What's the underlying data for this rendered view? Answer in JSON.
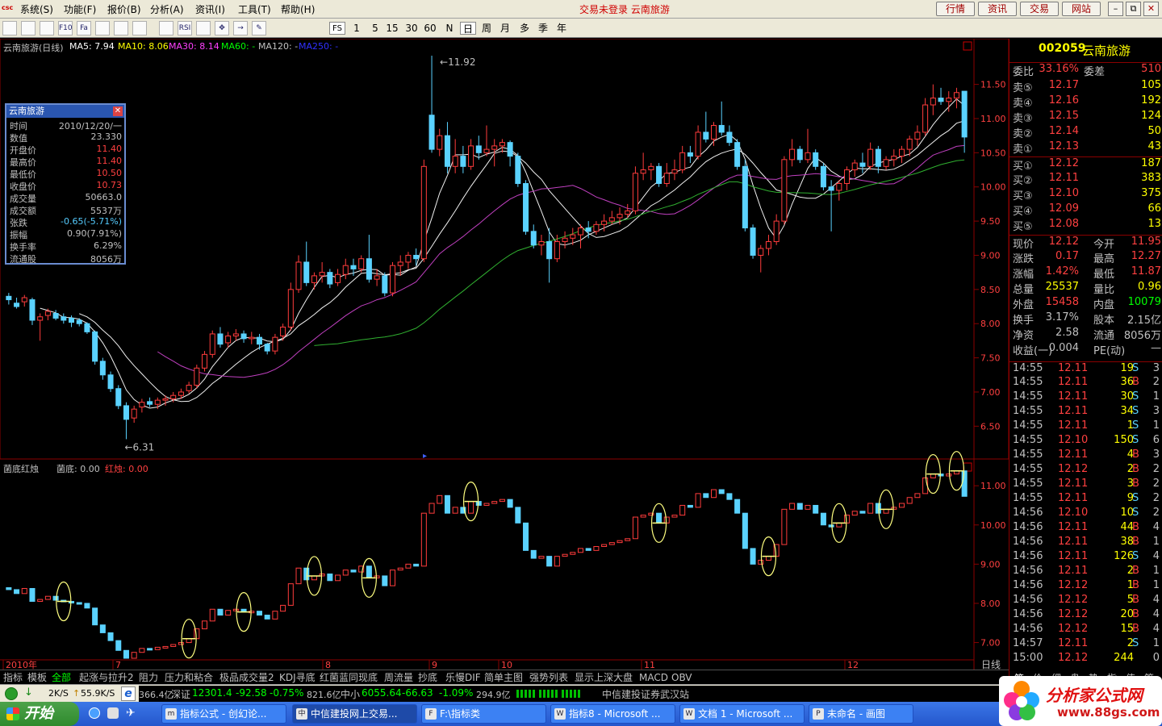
{
  "menubar": {
    "logo": "csc",
    "items": [
      "系统(S)",
      "功能(F)",
      "报价(B)",
      "分析(A)",
      "资讯(I)",
      "工具(T)",
      "帮助(H)"
    ],
    "notice": "交易未登录 云南旅游",
    "buttons": [
      "行情",
      "资讯",
      "交易",
      "网站"
    ],
    "win_min": "–",
    "win_restore": "⧉",
    "win_close": "✕"
  },
  "toolbar": {
    "icons": [
      "list-icon",
      "grid-icon",
      "line-chart-icon",
      "f10-icon",
      "fa-icon",
      "candlestick-icon",
      "bar-icon",
      "compare-icon",
      "multi-icon",
      "rsi-icon",
      "pattern-icon",
      "move-icon",
      "arrow-icon",
      "pencil-icon"
    ],
    "icon_text": [
      "",
      "",
      "",
      "F10",
      "Fa",
      "",
      "",
      "",
      "",
      "RSI",
      "",
      "✥",
      "→",
      "✎"
    ],
    "fs": "FS",
    "periods": [
      "1",
      "5",
      "15",
      "30",
      "60",
      "N",
      "日",
      "周",
      "月",
      "多",
      "季",
      "年"
    ],
    "selected_period": "日"
  },
  "chart_header": {
    "name": "云南旅游(日线)",
    "ma5": "MA5: 7.94",
    "ma10": "MA10: 8.06",
    "ma30": "MA30: 8.14",
    "ma60": "MA60: -",
    "ma120": "MA120: -",
    "ma250": "MA250: -"
  },
  "infobox": {
    "title": "云南旅游",
    "close": "✕",
    "rows": [
      {
        "k": "时间",
        "v": "2010/12/20/一",
        "c": "#c0c0c0"
      },
      {
        "k": "数值",
        "v": "23.330",
        "c": "#c0c0c0"
      },
      {
        "k": "开盘价",
        "v": "11.40",
        "c": "#ff4040"
      },
      {
        "k": "最高价",
        "v": "11.40",
        "c": "#ff4040"
      },
      {
        "k": "最低价",
        "v": "10.50",
        "c": "#ff4040"
      },
      {
        "k": "收盘价",
        "v": "10.73",
        "c": "#ff4040"
      },
      {
        "k": "成交量",
        "v": "50663.0",
        "c": "#c0c0c0"
      },
      {
        "k": "成交额",
        "v": "5537万",
        "c": "#c0c0c0"
      },
      {
        "k": "张跌",
        "v": "-0.65(-5.71%)",
        "c": "#5cf"
      },
      {
        "k": "振幅",
        "v": "0.90(7.91%)",
        "c": "#c0c0c0"
      },
      {
        "k": "换手率",
        "v": "6.29%",
        "c": "#c0c0c0"
      },
      {
        "k": "流通股",
        "v": "8056万",
        "c": "#c0c0c0"
      }
    ]
  },
  "price_axis": [
    "11.50",
    "11.00",
    "10.50",
    "10.00",
    "9.50",
    "9.00",
    "8.50",
    "8.00",
    "7.50",
    "7.00",
    "6.50"
  ],
  "annotations": {
    "high": "11.92",
    "low": "6.31"
  },
  "indicator_header": {
    "name": "菌底红烛",
    "v1": "菌底: 0.00",
    "v2": "红烛: 0.00"
  },
  "indicator_axis": [
    "11.00",
    "10.00",
    "9.00",
    "8.00",
    "7.00"
  ],
  "date_axis": [
    "2010年",
    "7",
    "8",
    "9",
    "10",
    "11",
    "12"
  ],
  "period_label": "日线",
  "tabs": [
    "指标",
    "模板",
    "全部",
    "起涨与拉升2",
    "阻力",
    "压力和粘合",
    "极品成交量2",
    "KDJ寻底",
    "红菌蓝同现底",
    "周流量",
    "抄底",
    "乐慢DIF",
    "简单主图",
    "强势列表",
    "显示上深大盘",
    "MACD",
    "OBV"
  ],
  "quote": {
    "code": "002059",
    "name": "云南旅游",
    "webi_label": "委比",
    "webi": "33.16%",
    "wecha_label": "委差",
    "wecha": "510",
    "asks": [
      {
        "l": "卖⑤",
        "p": "12.17",
        "v": "105"
      },
      {
        "l": "卖④",
        "p": "12.16",
        "v": "192"
      },
      {
        "l": "卖③",
        "p": "12.15",
        "v": "124"
      },
      {
        "l": "卖②",
        "p": "12.14",
        "v": "50"
      },
      {
        "l": "卖①",
        "p": "12.13",
        "v": "43"
      }
    ],
    "bids": [
      {
        "l": "买①",
        "p": "12.12",
        "v": "187"
      },
      {
        "l": "买②",
        "p": "12.11",
        "v": "383"
      },
      {
        "l": "买③",
        "p": "12.10",
        "v": "375"
      },
      {
        "l": "买④",
        "p": "12.09",
        "v": "66"
      },
      {
        "l": "买⑤",
        "p": "12.08",
        "v": "13"
      }
    ],
    "stats": [
      {
        "l1": "现价",
        "v1": "12.12",
        "c1": "#ff4040",
        "l2": "今开",
        "v2": "11.95",
        "c2": "#ff4040"
      },
      {
        "l1": "涨跌",
        "v1": "0.17",
        "c1": "#ff4040",
        "l2": "最高",
        "v2": "12.27",
        "c2": "#ff4040"
      },
      {
        "l1": "涨幅",
        "v1": "1.42%",
        "c1": "#ff4040",
        "l2": "最低",
        "v2": "11.87",
        "c2": "#ff4040"
      },
      {
        "l1": "总量",
        "v1": "25537",
        "c1": "#ffff00",
        "l2": "量比",
        "v2": "0.96",
        "c2": "#ffff00"
      },
      {
        "l1": "外盘",
        "v1": "15458",
        "c1": "#ff4040",
        "l2": "内盘",
        "v2": "10079",
        "c2": "#00ff00"
      },
      {
        "l1": "换手",
        "v1": "3.17%",
        "c1": "#c0c0c0",
        "l2": "股本",
        "v2": "2.15亿",
        "c2": "#c0c0c0"
      },
      {
        "l1": "净资",
        "v1": "2.58",
        "c1": "#c0c0c0",
        "l2": "流通",
        "v2": "8056万",
        "c2": "#c0c0c0"
      },
      {
        "l1": "收益(一)",
        "v1": "0.004",
        "c1": "#c0c0c0",
        "l2": "PE(动)",
        "v2": "—",
        "c2": "#c0c0c0"
      }
    ],
    "ticks": [
      {
        "t": "14:55",
        "p": "12.11",
        "v": "19",
        "s": "S",
        "n": "3"
      },
      {
        "t": "14:55",
        "p": "12.11",
        "v": "36",
        "s": "B",
        "n": "2"
      },
      {
        "t": "14:55",
        "p": "12.11",
        "v": "30",
        "s": "S",
        "n": "1"
      },
      {
        "t": "14:55",
        "p": "12.11",
        "v": "34",
        "s": "S",
        "n": "3"
      },
      {
        "t": "14:55",
        "p": "12.11",
        "v": "1",
        "s": "S",
        "n": "1"
      },
      {
        "t": "14:55",
        "p": "12.10",
        "v": "150",
        "s": "S",
        "n": "6"
      },
      {
        "t": "14:55",
        "p": "12.11",
        "v": "4",
        "s": "B",
        "n": "3"
      },
      {
        "t": "14:55",
        "p": "12.12",
        "v": "2",
        "s": "B",
        "n": "2"
      },
      {
        "t": "14:55",
        "p": "12.11",
        "v": "3",
        "s": "B",
        "n": "2"
      },
      {
        "t": "14:55",
        "p": "12.11",
        "v": "9",
        "s": "S",
        "n": "2"
      },
      {
        "t": "14:56",
        "p": "12.10",
        "v": "10",
        "s": "S",
        "n": "2"
      },
      {
        "t": "14:56",
        "p": "12.11",
        "v": "44",
        "s": "B",
        "n": "4"
      },
      {
        "t": "14:56",
        "p": "12.11",
        "v": "38",
        "s": "B",
        "n": "1"
      },
      {
        "t": "14:56",
        "p": "12.11",
        "v": "126",
        "s": "S",
        "n": "4"
      },
      {
        "t": "14:56",
        "p": "12.11",
        "v": "2",
        "s": "B",
        "n": "1"
      },
      {
        "t": "14:56",
        "p": "12.12",
        "v": "1",
        "s": "B",
        "n": "1"
      },
      {
        "t": "14:56",
        "p": "12.12",
        "v": "5",
        "s": "B",
        "n": "4"
      },
      {
        "t": "14:56",
        "p": "12.12",
        "v": "20",
        "s": "B",
        "n": "4"
      },
      {
        "t": "14:56",
        "p": "12.12",
        "v": "15",
        "s": "B",
        "n": "4"
      },
      {
        "t": "14:57",
        "p": "12.11",
        "v": "2",
        "s": "S",
        "n": "1"
      },
      {
        "t": "15:00",
        "p": "12.12",
        "v": "244",
        "s": "",
        "n": "0"
      }
    ],
    "bottom_tabs": [
      "笔",
      "价",
      "细",
      "盘",
      "势",
      "指",
      "值",
      "筹"
    ]
  },
  "statusbar": {
    "icons": [
      "network-icon",
      "download-arrow-icon"
    ],
    "down": "2K/S",
    "up": "55.9K/S",
    "ie": "e",
    "market": "366.4亿",
    "sz_label": "深证",
    "sz": "12301.4",
    "sz_chg": "-92.58",
    "sz_pct": "-0.75%",
    "sz_amt": "821.6亿",
    "zx_label": "中小",
    "zx": "6055.64",
    "zx_chg": "-66.63",
    "zx_pct": "-1.09%",
    "zx_amt": "294.9亿",
    "broker": "中信建投证券武汉站"
  },
  "taskbar": {
    "start": "开始",
    "tasks": [
      {
        "icon": "m",
        "label": "指标公式 - 创幻论..."
      },
      {
        "icon": "中",
        "label": "中信建投网上交易..."
      },
      {
        "icon": "F",
        "label": "F:\\指标类"
      },
      {
        "icon": "W",
        "label": "指标8 - Microsoft ..."
      },
      {
        "icon": "W",
        "label": "文档 1 - Microsoft ..."
      },
      {
        "icon": "P",
        "label": "未命名 - 画图"
      }
    ]
  },
  "watermark": {
    "title": "分析家公式网",
    "url": "www.88gs.com"
  },
  "colors": {
    "up": "#ff3c3c",
    "down": "#5ad2ff",
    "ma5": "#ffffff",
    "ma10": "#ffff00",
    "ma30": "#ff40ff",
    "ma60": "#00ff00",
    "ma120": "#c0c0c0",
    "ma250": "#0000ff",
    "ma_drawn_white": "#f0f0f0",
    "ma_drawn_magenta": "#c040c0",
    "ma_drawn_green": "#30b030",
    "accent_red": "#8b0000"
  },
  "chart_data": {
    "type": "candlestick",
    "y_range": [
      6.15,
      12.05
    ],
    "candles": [
      [
        8.4,
        8.45,
        8.28,
        8.35
      ],
      [
        8.3,
        8.38,
        8.22,
        8.25
      ],
      [
        8.32,
        8.42,
        8.25,
        8.38
      ],
      [
        8.35,
        8.38,
        7.98,
        8.05
      ],
      [
        8.05,
        8.15,
        7.75,
        8.1
      ],
      [
        8.12,
        8.22,
        8.05,
        8.18
      ],
      [
        8.15,
        8.2,
        8.05,
        8.08
      ],
      [
        8.1,
        8.15,
        8.0,
        8.05
      ],
      [
        8.08,
        8.12,
        7.95,
        8.02
      ],
      [
        8.05,
        8.08,
        7.96,
        8.0
      ],
      [
        8.0,
        8.02,
        7.85,
        7.88
      ],
      [
        7.88,
        7.9,
        7.4,
        7.45
      ],
      [
        7.45,
        7.5,
        7.18,
        7.25
      ],
      [
        7.25,
        7.3,
        7.0,
        7.05
      ],
      [
        7.05,
        7.1,
        6.75,
        6.8
      ],
      [
        6.8,
        6.85,
        6.31,
        6.6
      ],
      [
        6.62,
        6.8,
        6.55,
        6.75
      ],
      [
        6.78,
        6.9,
        6.7,
        6.85
      ],
      [
        6.86,
        6.92,
        6.78,
        6.82
      ],
      [
        6.82,
        6.92,
        6.75,
        6.88
      ],
      [
        6.88,
        6.95,
        6.8,
        6.9
      ],
      [
        6.9,
        7.0,
        6.85,
        6.95
      ],
      [
        6.95,
        7.05,
        6.9,
        7.0
      ],
      [
        7.02,
        7.15,
        6.98,
        7.1
      ],
      [
        7.1,
        7.4,
        7.05,
        7.35
      ],
      [
        7.35,
        7.6,
        7.3,
        7.55
      ],
      [
        7.55,
        7.9,
        7.5,
        7.85
      ],
      [
        7.85,
        7.95,
        7.65,
        7.7
      ],
      [
        7.72,
        7.88,
        7.65,
        7.82
      ],
      [
        7.82,
        7.92,
        7.75,
        7.85
      ],
      [
        7.85,
        7.9,
        7.72,
        7.78
      ],
      [
        7.78,
        7.88,
        7.7,
        7.8
      ],
      [
        7.8,
        7.85,
        7.62,
        7.7
      ],
      [
        7.7,
        7.72,
        7.55,
        7.6
      ],
      [
        7.6,
        7.85,
        7.55,
        7.8
      ],
      [
        7.82,
        8.0,
        7.75,
        7.95
      ],
      [
        7.95,
        8.6,
        7.9,
        8.5
      ],
      [
        8.5,
        9.0,
        8.45,
        8.9
      ],
      [
        8.9,
        9.2,
        8.55,
        8.6
      ],
      [
        8.6,
        8.75,
        8.5,
        8.7
      ],
      [
        8.7,
        8.9,
        8.6,
        8.75
      ],
      [
        8.75,
        8.8,
        8.52,
        8.58
      ],
      [
        8.6,
        8.8,
        8.55,
        8.72
      ],
      [
        8.72,
        8.95,
        8.65,
        8.85
      ],
      [
        8.85,
        8.95,
        8.7,
        8.8
      ],
      [
        8.8,
        9.0,
        8.75,
        8.95
      ],
      [
        8.95,
        9.3,
        8.6,
        8.65
      ],
      [
        8.65,
        8.8,
        8.55,
        8.7
      ],
      [
        8.7,
        8.75,
        8.4,
        8.45
      ],
      [
        8.45,
        8.9,
        8.4,
        8.85
      ],
      [
        8.85,
        9.0,
        8.7,
        8.9
      ],
      [
        8.9,
        9.05,
        8.8,
        9.0
      ],
      [
        9.0,
        9.1,
        8.85,
        8.95
      ],
      [
        8.95,
        10.4,
        8.9,
        10.3
      ],
      [
        11.05,
        11.92,
        10.5,
        10.55
      ],
      [
        10.55,
        10.85,
        10.45,
        10.75
      ],
      [
        10.75,
        10.95,
        10.2,
        10.3
      ],
      [
        10.3,
        10.7,
        10.2,
        10.45
      ],
      [
        10.45,
        10.6,
        10.2,
        10.3
      ],
      [
        10.3,
        10.7,
        10.25,
        10.6
      ],
      [
        10.6,
        10.75,
        10.4,
        10.5
      ],
      [
        10.5,
        10.9,
        10.45,
        10.55
      ],
      [
        10.55,
        10.7,
        10.3,
        10.6
      ],
      [
        10.6,
        10.7,
        10.5,
        10.65
      ],
      [
        10.65,
        10.68,
        10.3,
        10.45
      ],
      [
        10.45,
        10.5,
        10.0,
        10.05
      ],
      [
        10.05,
        10.1,
        9.3,
        9.35
      ],
      [
        9.35,
        9.45,
        9.1,
        9.15
      ],
      [
        9.15,
        9.3,
        9.0,
        9.2
      ],
      [
        9.2,
        9.4,
        8.6,
        8.95
      ],
      [
        8.95,
        9.3,
        8.9,
        9.2
      ],
      [
        9.2,
        9.35,
        9.1,
        9.25
      ],
      [
        9.25,
        9.4,
        9.15,
        9.3
      ],
      [
        9.3,
        9.45,
        9.1,
        9.4
      ],
      [
        9.4,
        9.5,
        9.25,
        9.35
      ],
      [
        9.35,
        9.5,
        9.3,
        9.45
      ],
      [
        9.45,
        9.6,
        9.35,
        9.5
      ],
      [
        9.5,
        9.65,
        9.45,
        9.55
      ],
      [
        9.55,
        9.7,
        9.45,
        9.6
      ],
      [
        9.6,
        9.75,
        9.55,
        9.65
      ],
      [
        9.65,
        10.3,
        9.6,
        10.2
      ],
      [
        10.2,
        10.5,
        10.1,
        10.25
      ],
      [
        10.25,
        10.35,
        10.1,
        10.3
      ],
      [
        10.3,
        10.35,
        10.0,
        10.05
      ],
      [
        10.05,
        10.35,
        10.0,
        10.2
      ],
      [
        10.2,
        10.4,
        10.1,
        10.25
      ],
      [
        10.25,
        10.6,
        10.2,
        10.5
      ],
      [
        10.5,
        10.6,
        10.35,
        10.45
      ],
      [
        10.45,
        10.9,
        10.4,
        10.8
      ],
      [
        10.8,
        11.1,
        10.65,
        10.7
      ],
      [
        10.7,
        10.95,
        10.6,
        10.9
      ],
      [
        10.9,
        11.25,
        10.75,
        10.8
      ],
      [
        10.8,
        10.9,
        10.6,
        10.65
      ],
      [
        10.65,
        10.7,
        10.25,
        10.3
      ],
      [
        10.3,
        10.4,
        9.35,
        9.4
      ],
      [
        9.4,
        9.45,
        8.95,
        9.0
      ],
      [
        9.0,
        9.15,
        8.75,
        9.1
      ],
      [
        9.1,
        9.3,
        9.0,
        9.2
      ],
      [
        9.2,
        9.6,
        9.15,
        9.5
      ],
      [
        9.5,
        10.45,
        9.45,
        10.4
      ],
      [
        10.4,
        10.7,
        10.3,
        10.55
      ],
      [
        10.55,
        10.6,
        10.35,
        10.4
      ],
      [
        10.4,
        10.85,
        10.35,
        10.5
      ],
      [
        10.5,
        10.55,
        10.25,
        10.3
      ],
      [
        10.3,
        10.35,
        9.95,
        10.0
      ],
      [
        10.0,
        10.1,
        9.35,
        9.95
      ],
      [
        9.95,
        10.1,
        9.8,
        10.05
      ],
      [
        10.05,
        10.3,
        9.95,
        10.25
      ],
      [
        10.25,
        10.4,
        10.15,
        10.35
      ],
      [
        10.35,
        10.5,
        10.2,
        10.3
      ],
      [
        10.3,
        10.65,
        10.25,
        10.55
      ],
      [
        10.55,
        10.6,
        10.2,
        10.3
      ],
      [
        10.3,
        10.45,
        10.25,
        10.4
      ],
      [
        10.4,
        10.55,
        10.3,
        10.45
      ],
      [
        10.45,
        10.6,
        10.35,
        10.55
      ],
      [
        10.55,
        10.75,
        10.45,
        10.7
      ],
      [
        10.7,
        10.9,
        10.6,
        10.8
      ],
      [
        10.8,
        11.3,
        10.75,
        11.2
      ],
      [
        11.2,
        11.5,
        11.05,
        11.3
      ],
      [
        11.3,
        11.45,
        11.2,
        11.25
      ],
      [
        11.25,
        11.4,
        11.1,
        11.3
      ],
      [
        11.3,
        11.45,
        11.15,
        11.38
      ],
      [
        11.4,
        11.4,
        10.5,
        10.73
      ]
    ]
  }
}
